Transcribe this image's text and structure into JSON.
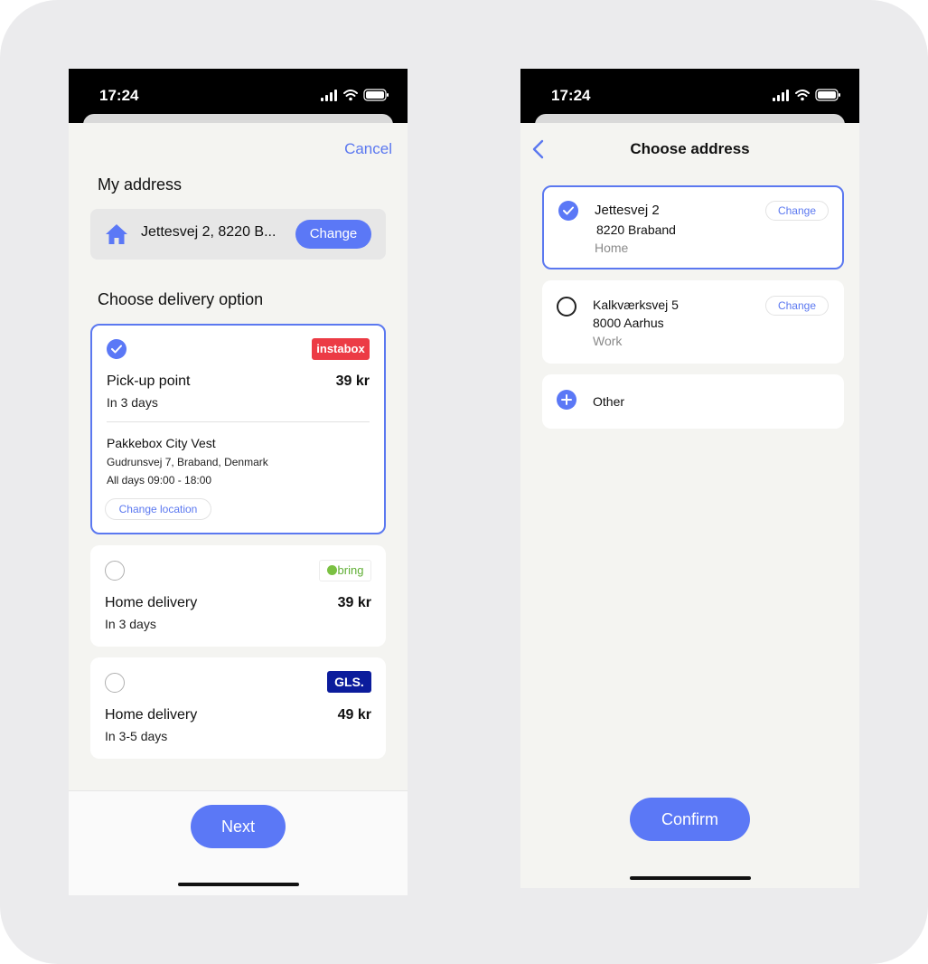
{
  "status": {
    "time": "17:24"
  },
  "delivery_screen": {
    "cancel_label": "Cancel",
    "my_address_title": "My address",
    "current_address": "Jettesvej 2, 8220 B...",
    "change_label": "Change",
    "choose_delivery_title": "Choose delivery option",
    "options": [
      {
        "carrier": "instabox",
        "title": "Pick-up point",
        "eta": "In 3 days",
        "price": "39 kr",
        "location_name": "Pakkebox City Vest",
        "location_address": "Gudrunsvej 7, Braband, Denmark",
        "hours": "All days 09:00 - 18:00",
        "change_location_label": "Change location"
      },
      {
        "carrier": "bring",
        "title": "Home delivery",
        "eta": "In 3 days",
        "price": "39 kr"
      },
      {
        "carrier": "GLS.",
        "title": "Home delivery",
        "eta": "In 3-5 days",
        "price": "49 kr"
      }
    ],
    "next_label": "Next"
  },
  "address_screen": {
    "title": "Choose address",
    "addresses": [
      {
        "street": "Jettesvej 2",
        "city": "8220 Braband",
        "tag": "Home",
        "change_label": "Change"
      },
      {
        "street": "Kalkværksvej 5",
        "city": "8000 Aarhus",
        "tag": "Work",
        "change_label": "Change"
      }
    ],
    "other_label": "Other",
    "confirm_label": "Confirm"
  },
  "colors": {
    "accent": "#5b78f6",
    "instabox": "#ec3b45",
    "gls": "#0b1c9c",
    "bring": "#7bc142"
  }
}
